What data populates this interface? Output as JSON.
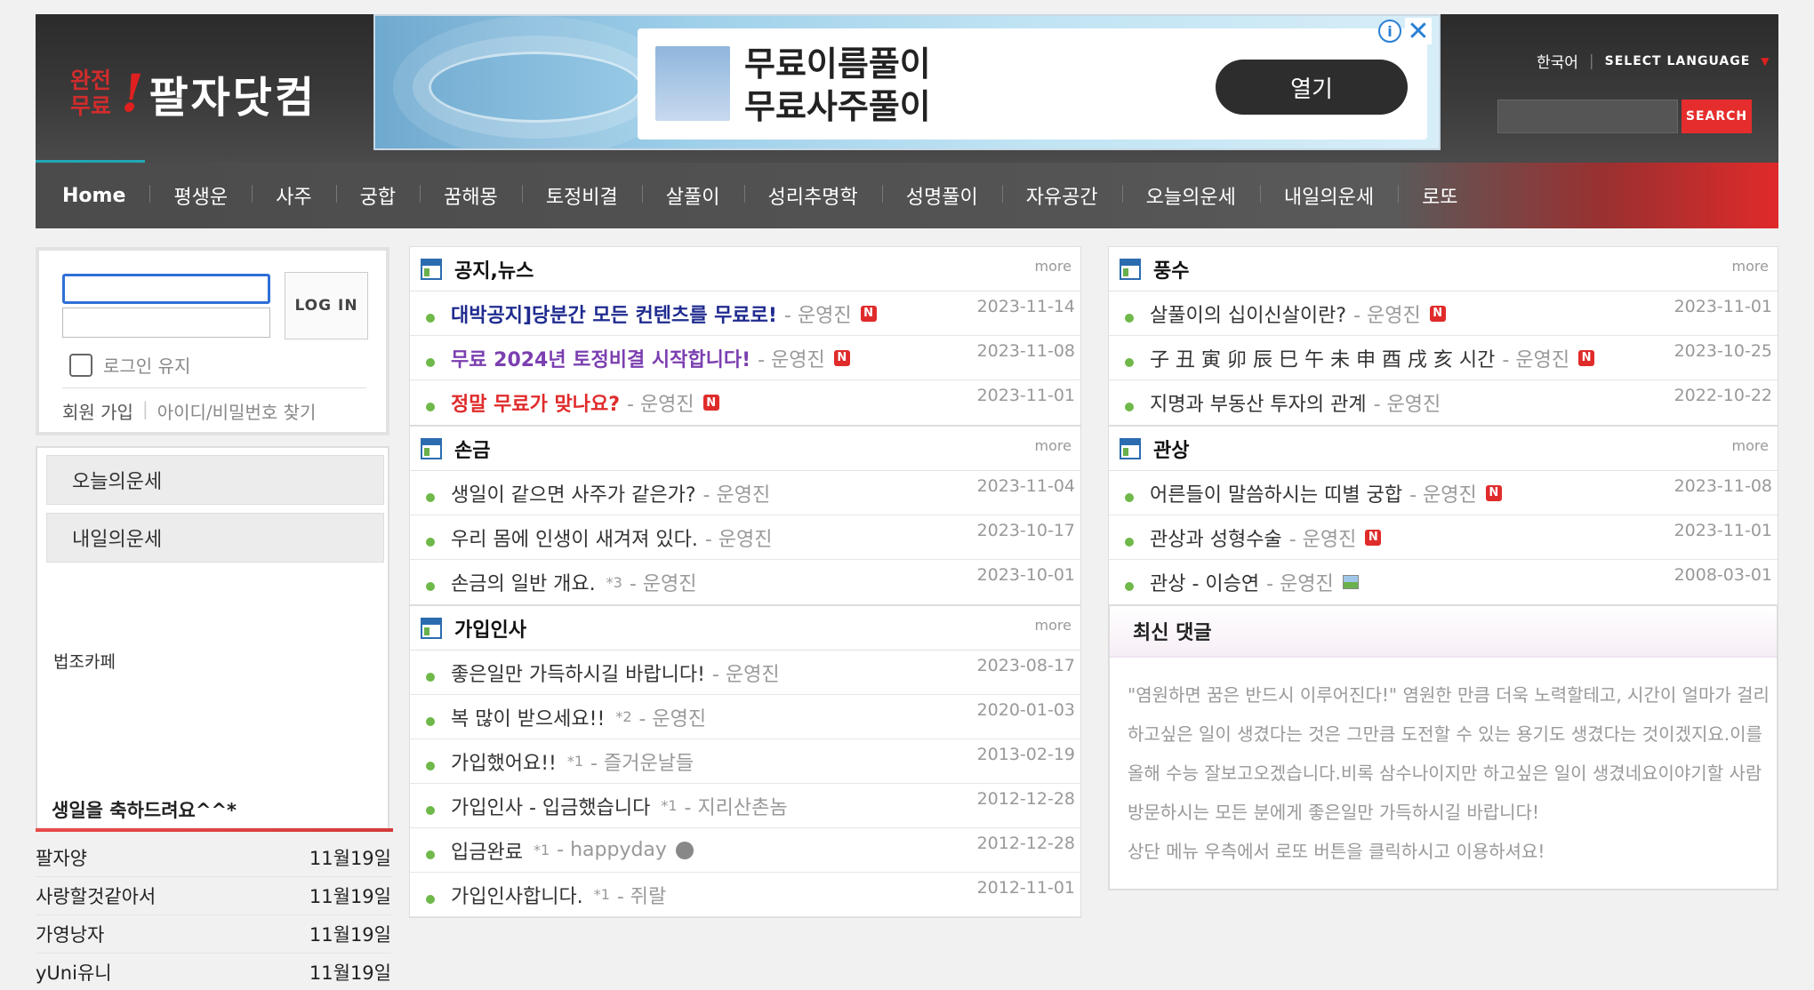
{
  "header": {
    "logo_small_line1": "완전",
    "logo_small_line2": "무료",
    "logo_mark": "!",
    "logo_main": "팔자닷컴",
    "lang_current": "한국어",
    "lang_select": "SELECT LANGUAGE",
    "search_button": "SEARCH"
  },
  "ad": {
    "line1": "무료이름풀이",
    "line2": "무료사주풀이",
    "open_button": "열기",
    "info": "i",
    "close": "✕"
  },
  "nav": {
    "items": [
      "Home",
      "평생운",
      "사주",
      "궁합",
      "꿈해몽",
      "토정비결",
      "살풀이",
      "성리추명학",
      "성명풀이",
      "자유공간",
      "오늘의운세",
      "내일의운세",
      "로또"
    ]
  },
  "login": {
    "button": "LOG IN",
    "keep": "로그인 유지",
    "join": "회원 가입",
    "divider": "|",
    "find": "아이디/비밀번호 찾기"
  },
  "side": {
    "today": "오늘의운세",
    "tomorrow": "내일의운세",
    "cafe": "법조카페"
  },
  "birthday": {
    "title": "생일을 축하드려요^^*",
    "items": [
      {
        "name": "팔자양",
        "date": "11월19일"
      },
      {
        "name": "사랑할것같아서",
        "date": "11월19일"
      },
      {
        "name": "가영낭자",
        "date": "11월19일"
      },
      {
        "name": "yUni유니",
        "date": "11월19일"
      }
    ]
  },
  "boards": {
    "notice": {
      "title": "공지,뉴스",
      "more": "more",
      "posts": [
        {
          "title": "대박공지]당분간 모든 컨텐츠를 무료로!",
          "author": "- 운영진",
          "date": "2023-11-14",
          "badge": "N"
        },
        {
          "title": "무료 2024년 토정비결 시작합니다!",
          "author": "- 운영진",
          "date": "2023-11-08",
          "badge": "N"
        },
        {
          "title": "정말 무료가 맞나요?",
          "author": "- 운영진",
          "date": "2023-11-01",
          "badge": "N"
        }
      ]
    },
    "palm": {
      "title": "손금",
      "more": "more",
      "posts": [
        {
          "title": "생일이 같으면 사주가 같은가?",
          "author": "- 운영진",
          "date": "2023-11-04"
        },
        {
          "title": "우리 몸에 인생이 새겨져 있다.",
          "author": "- 운영진",
          "date": "2023-10-17"
        },
        {
          "title": "손금의 일반 개요.",
          "count": "*3",
          "author": "- 운영진",
          "date": "2023-10-01"
        }
      ]
    },
    "greet": {
      "title": "가입인사",
      "more": "more",
      "posts": [
        {
          "title": "좋은일만 가득하시길 바랍니다!",
          "author": "- 운영진",
          "date": "2023-08-17"
        },
        {
          "title": "복 많이 받으세요!!",
          "count": "*2",
          "author": "- 운영진",
          "date": "2020-01-03"
        },
        {
          "title": "가입했어요!!",
          "count": "*1",
          "author": "- 즐거운날들",
          "date": "2013-02-19"
        },
        {
          "title": "가입인사 - 입금했습니다",
          "count": "*1",
          "author": "- 지리산촌놈",
          "date": "2012-12-28"
        },
        {
          "title": "입금완료",
          "count": "*1",
          "author": "- happyday",
          "date": "2012-12-28"
        },
        {
          "title": "가입인사합니다.",
          "count": "*1",
          "author": "- 쥐랄",
          "date": "2012-11-01"
        }
      ]
    },
    "fengshui": {
      "title": "풍수",
      "more": "more",
      "posts": [
        {
          "title": "살풀이의 십이신살이란?",
          "author": "- 운영진",
          "date": "2023-11-01",
          "badge": "N"
        },
        {
          "title": "子 丑 寅 卯 辰 巳 午 未 申 酉 戌 亥 시간",
          "author": "- 운영진",
          "date": "2023-10-25",
          "badge": "N"
        },
        {
          "title": "지명과 부동산 투자의 관계",
          "author": "- 운영진",
          "date": "2022-10-22"
        }
      ]
    },
    "face": {
      "title": "관상",
      "more": "more",
      "posts": [
        {
          "title": "어른들이 말씀하시는 띠별 궁합",
          "author": "- 운영진",
          "date": "2023-11-08",
          "badge": "N"
        },
        {
          "title": "관상과 성형수술",
          "author": "- 운영진",
          "date": "2023-11-01",
          "badge": "N"
        },
        {
          "title": "관상 - 이승연",
          "author": "- 운영진",
          "date": "2008-03-01"
        }
      ]
    }
  },
  "comments": {
    "title": "최신 댓글",
    "items": [
      "\"염원하면 꿈은 반드시 이루어진다!\" 염원한 만큼 더욱 노력할테고, 시간이 얼마가 걸리",
      "하고싶은 일이 생겼다는 것은 그만큼 도전할 수 있는 용기도 생겼다는 것이겠지요.이를",
      "올해 수능 잘보고오겠습니다.비록 삼수나이지만 하고싶은 일이 생겼네요이야기할 사람",
      "방문하시는 모든 분에게 좋은일만 가득하시길 바랍니다!",
      "상단 메뉴 우측에서 로또 버튼을 클릭하시고 이용하셔요!"
    ]
  },
  "colors": {
    "accent_red": "#e62d2d",
    "nav_teal": "#1fa9b5",
    "bullet_green": "#6fb84a"
  }
}
